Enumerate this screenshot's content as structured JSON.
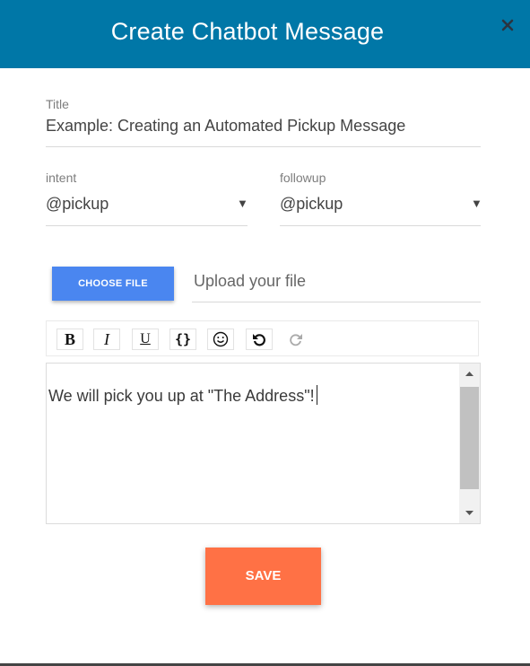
{
  "header": {
    "title": "Create Chatbot Message"
  },
  "form": {
    "title_label": "Title",
    "title_value": "Example: Creating an Automated Pickup Message",
    "intent_label": "intent",
    "intent_value": "@pickup",
    "followup_label": "followup",
    "followup_value": "@pickup",
    "caret": "▼",
    "choose_file_label": "CHOOSE FILE",
    "upload_placeholder": "Upload your file"
  },
  "toolbar": {
    "items": [
      "bold-icon",
      "italic-icon",
      "underline-icon",
      "code-braces-icon",
      "emoji-icon",
      "undo-icon",
      "redo-icon"
    ],
    "bold": "B",
    "italic": "I",
    "underline": "U",
    "braces": "{}"
  },
  "editor": {
    "text": "We will pick you up at \"The Address\"!"
  },
  "actions": {
    "save_label": "SAVE"
  },
  "colors": {
    "header": "#0077a7",
    "choose_button": "#4a86f0",
    "save_button": "#ff7145"
  }
}
